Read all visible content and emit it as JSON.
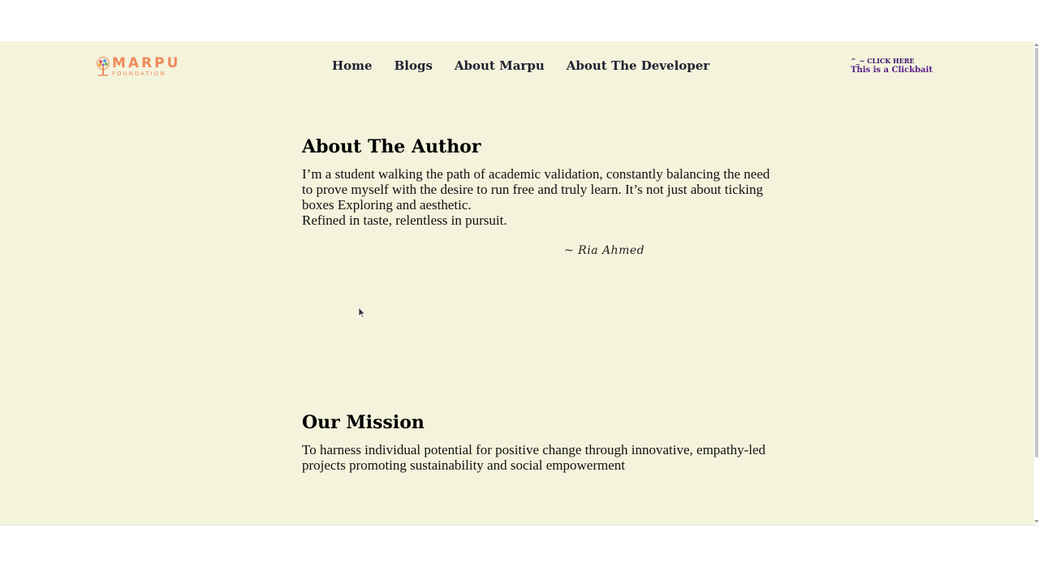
{
  "logo": {
    "title": "MARPU",
    "subtitle": "FOUNDATION"
  },
  "nav": {
    "items": [
      {
        "label": "Home"
      },
      {
        "label": "Blogs"
      },
      {
        "label": "About Marpu"
      },
      {
        "label": "About The Developer"
      }
    ]
  },
  "clickbait": {
    "line1": "^_~ CLICK HERE",
    "line2": "This is a Clickbait"
  },
  "author": {
    "heading": "About The Author",
    "paragraph1": "I’m a student walking the path of academic validation, constantly balancing the need to prove myself with the desire to run free and truly learn. It’s not just about ticking boxes Exploring and aesthetic.",
    "paragraph2": "Refined in taste, relentless in pursuit.",
    "signature": "~ Ria Ahmed"
  },
  "mission": {
    "heading": "Our Mission",
    "text": "To harness individual potential for positive change through innovative, empathy-led projects promoting sustainability and social empowerment"
  },
  "colors": {
    "page_bg": "#f4f3dc",
    "brand": "#f08a5d",
    "nav_text": "#1f2130",
    "clickbait": "#5a1b8a"
  }
}
